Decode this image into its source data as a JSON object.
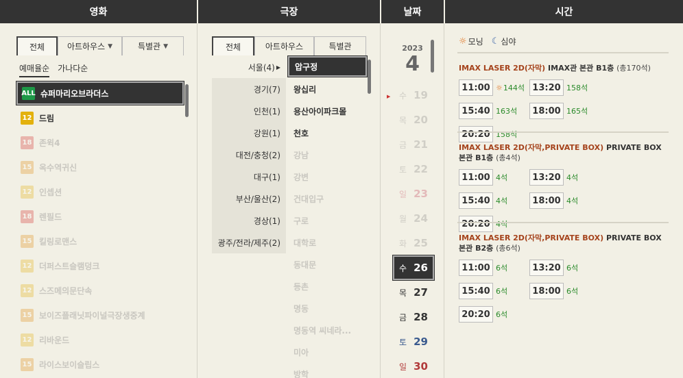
{
  "headers": {
    "movie": "영화",
    "theater": "극장",
    "date": "날짜",
    "time": "시간"
  },
  "movie": {
    "tabs": [
      {
        "label": "전체"
      },
      {
        "label": "아트하우스"
      },
      {
        "label": "특별관"
      }
    ],
    "sort": [
      "예매율순",
      "가나다순"
    ],
    "items": [
      {
        "rating": "ALL",
        "title": "슈퍼마리오브라더스",
        "state": "sel"
      },
      {
        "rating": "12",
        "title": "드림",
        "state": "normal"
      },
      {
        "rating": "18",
        "title": "존윅4",
        "state": "dim"
      },
      {
        "rating": "15",
        "title": "옥수역귀신",
        "state": "dim"
      },
      {
        "rating": "12",
        "title": "인셉션",
        "state": "dim"
      },
      {
        "rating": "18",
        "title": "렌필드",
        "state": "dim"
      },
      {
        "rating": "15",
        "title": "킬링로맨스",
        "state": "dim"
      },
      {
        "rating": "12",
        "title": "더퍼스트슬램덩크",
        "state": "dim"
      },
      {
        "rating": "12",
        "title": "스즈메의문단속",
        "state": "dim"
      },
      {
        "rating": "15",
        "title": "보이즈플래닛파이널극장생중계",
        "state": "dim"
      },
      {
        "rating": "12",
        "title": "리바운드",
        "state": "dim"
      },
      {
        "rating": "15",
        "title": "라이스보이슬립스",
        "state": "dim"
      }
    ]
  },
  "theater": {
    "tabs": [
      {
        "label": "전체"
      },
      {
        "label": "아트하우스"
      },
      {
        "label": "특별관"
      }
    ],
    "regions": [
      "서울(4)",
      "경기(7)",
      "인천(1)",
      "강원(1)",
      "대전/충청(2)",
      "대구(1)",
      "부산/울산(2)",
      "경상(1)",
      "광주/전라/제주(2)"
    ],
    "theaters": [
      {
        "name": "압구정",
        "state": "sel"
      },
      {
        "name": "왕십리",
        "state": "normal"
      },
      {
        "name": "용산아이파크몰",
        "state": "normal"
      },
      {
        "name": "천호",
        "state": "normal"
      },
      {
        "name": "강남",
        "state": "dim"
      },
      {
        "name": "강변",
        "state": "dim"
      },
      {
        "name": "건대입구",
        "state": "dim"
      },
      {
        "name": "구로",
        "state": "dim"
      },
      {
        "name": "대학로",
        "state": "dim"
      },
      {
        "name": "동대문",
        "state": "dim"
      },
      {
        "name": "등촌",
        "state": "dim"
      },
      {
        "name": "명동",
        "state": "dim"
      },
      {
        "name": "명동역 씨네라...",
        "state": "dim"
      },
      {
        "name": "미아",
        "state": "dim"
      },
      {
        "name": "방학",
        "state": "dim"
      }
    ]
  },
  "date": {
    "year": "2023",
    "month": "4",
    "days": [
      {
        "dow": "수",
        "day": "19",
        "state": "dim",
        "kind": "wk"
      },
      {
        "dow": "목",
        "day": "20",
        "state": "dim",
        "kind": "wk"
      },
      {
        "dow": "금",
        "day": "21",
        "state": "dim",
        "kind": "wk"
      },
      {
        "dow": "토",
        "day": "22",
        "state": "dim",
        "kind": "wk"
      },
      {
        "dow": "일",
        "day": "23",
        "state": "dim",
        "kind": "sun"
      },
      {
        "dow": "월",
        "day": "24",
        "state": "dim",
        "kind": "wk"
      },
      {
        "dow": "화",
        "day": "25",
        "state": "dim",
        "kind": "wk"
      },
      {
        "dow": "수",
        "day": "26",
        "state": "sel",
        "kind": "wk"
      },
      {
        "dow": "목",
        "day": "27",
        "state": "normal",
        "kind": "wk"
      },
      {
        "dow": "금",
        "day": "28",
        "state": "normal",
        "kind": "wk"
      },
      {
        "dow": "토",
        "day": "29",
        "state": "normal",
        "kind": "sat"
      },
      {
        "dow": "일",
        "day": "30",
        "state": "normal",
        "kind": "sun"
      }
    ]
  },
  "time": {
    "legend": {
      "morning": "모닝",
      "night": "심야"
    },
    "halls": [
      {
        "format": "IMAX LASER 2D(자막)",
        "name": "IMAX관 본관 B1층",
        "total": "(총170석)",
        "slots": [
          {
            "time": "11:00",
            "seats": "144석",
            "morning": true
          },
          {
            "time": "13:20",
            "seats": "158석",
            "morning": false
          },
          {
            "time": "15:40",
            "seats": "163석",
            "morning": false
          },
          {
            "time": "18:00",
            "seats": "165석",
            "morning": false
          },
          {
            "time": "20:20",
            "seats": "158석",
            "morning": false
          }
        ]
      },
      {
        "format": "IMAX LASER 2D(자막,PRIVATE BOX)",
        "name": "PRIVATE BOX 본관 B1층",
        "total": "(총4석)",
        "slots": [
          {
            "time": "11:00",
            "seats": "4석",
            "morning": false
          },
          {
            "time": "13:20",
            "seats": "4석",
            "morning": false
          },
          {
            "time": "15:40",
            "seats": "4석",
            "morning": false
          },
          {
            "time": "18:00",
            "seats": "4석",
            "morning": false
          },
          {
            "time": "20:20",
            "seats": "4석",
            "morning": false
          }
        ]
      },
      {
        "format": "IMAX LASER 2D(자막,PRIVATE BOX)",
        "name": "PRIVATE BOX 본관 B2층",
        "total": "(총6석)",
        "slots": [
          {
            "time": "11:00",
            "seats": "6석",
            "morning": false
          },
          {
            "time": "13:20",
            "seats": "6석",
            "morning": false
          },
          {
            "time": "15:40",
            "seats": "6석",
            "morning": false
          },
          {
            "time": "18:00",
            "seats": "6석",
            "morning": false
          },
          {
            "time": "20:20",
            "seats": "6석",
            "morning": false
          }
        ]
      }
    ]
  }
}
